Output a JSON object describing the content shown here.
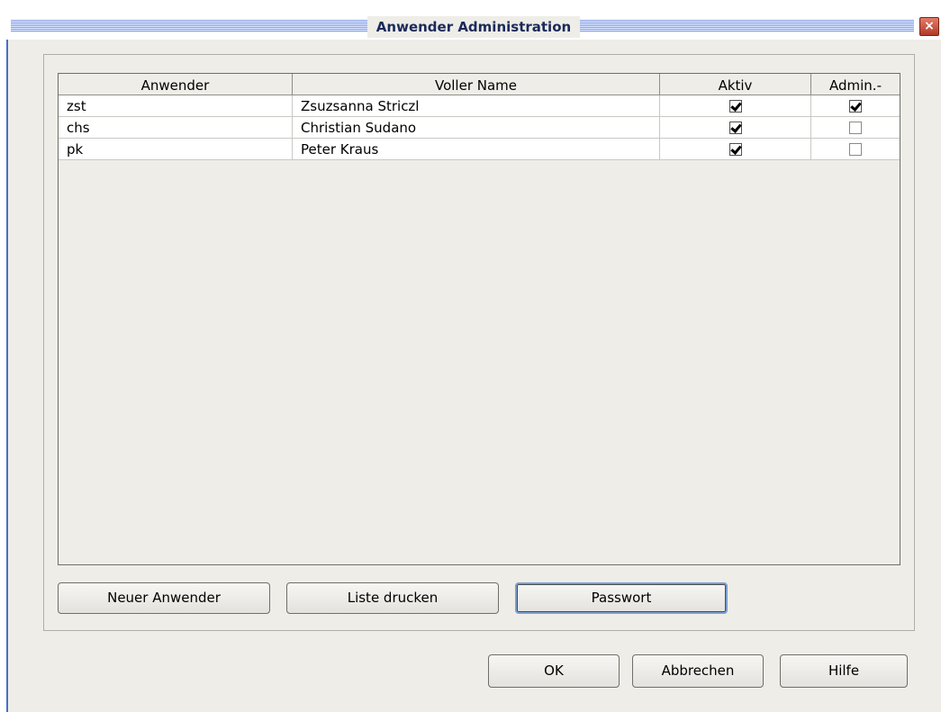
{
  "window": {
    "title": "Anwender Administration",
    "close_label": "×"
  },
  "table": {
    "columns": [
      "Anwender",
      "Voller Name",
      "Aktiv",
      "Admin.-rechte"
    ],
    "rows": [
      {
        "user": "zst",
        "full_name": "Zsuzsanna Striczl",
        "active": true,
        "admin": true
      },
      {
        "user": "chs",
        "full_name": "Christian Sudano",
        "active": true,
        "admin": false
      },
      {
        "user": "pk",
        "full_name": "Peter Kraus",
        "active": true,
        "admin": false
      }
    ]
  },
  "panel_buttons": {
    "new_user": "Neuer Anwender",
    "print_list": "Liste drucken",
    "password": "Passwort"
  },
  "dialog_buttons": {
    "ok": "OK",
    "cancel": "Abbrechen",
    "help": "Hilfe"
  },
  "colors": {
    "background": "#eeede8",
    "title_text": "#1b2a5a",
    "close_button": "#c4513c",
    "focus_ring": "#7b9fd0"
  }
}
